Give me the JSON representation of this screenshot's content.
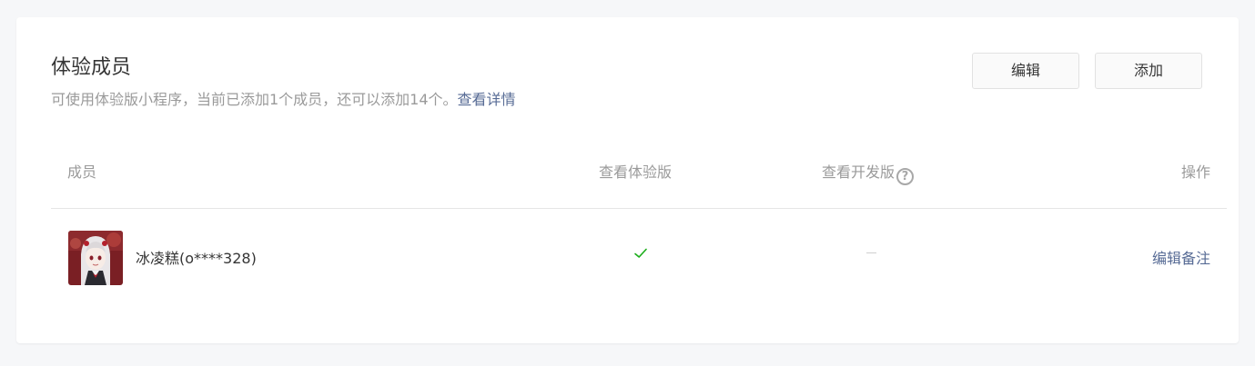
{
  "section": {
    "title": "体验成员",
    "description": "可使用体验版小程序，当前已添加1个成员，还可以添加14个。",
    "details_link": "查看详情"
  },
  "buttons": {
    "edit_label": "编辑",
    "add_label": "添加"
  },
  "table": {
    "headers": {
      "member": "成员",
      "view_experience": "查看体验版",
      "view_development": "查看开发版",
      "help_icon_glyph": "?",
      "actions": "操作"
    },
    "rows": [
      {
        "name": "冰凌糕(o****328)",
        "view_experience": "check-icon",
        "view_development": "dash-icon",
        "action": "编辑备注"
      }
    ]
  },
  "colors": {
    "link": "#576b95",
    "check": "#1aad19",
    "muted": "#9a9a9a",
    "text": "#353535"
  }
}
